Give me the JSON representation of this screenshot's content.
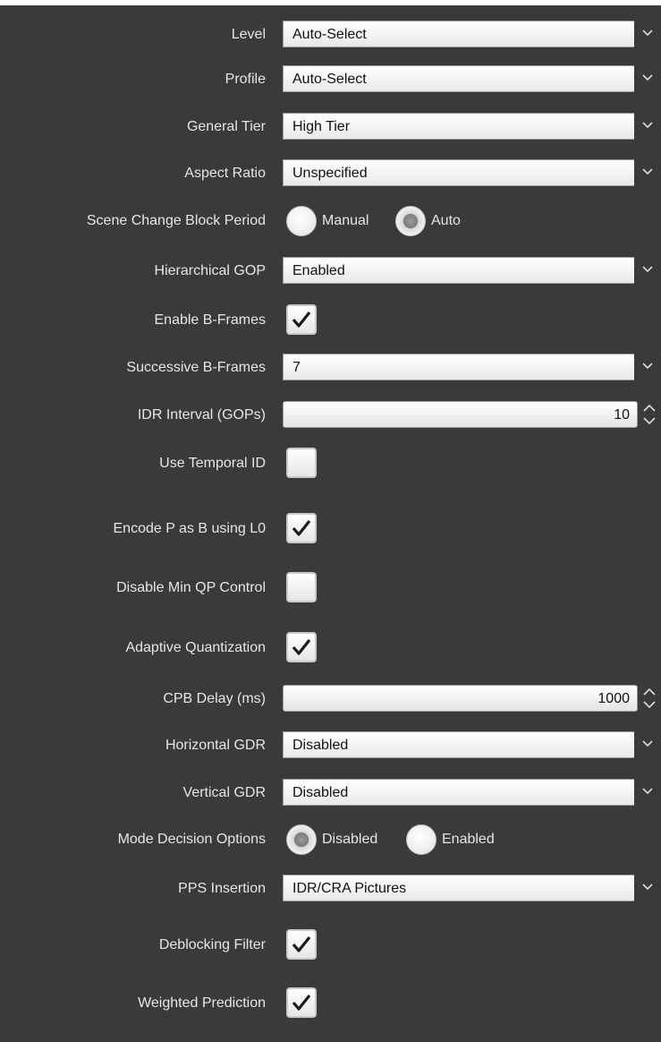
{
  "settings": {
    "level": {
      "label": "Level",
      "value": "Auto-Select"
    },
    "profile": {
      "label": "Profile",
      "value": "Auto-Select"
    },
    "general_tier": {
      "label": "General Tier",
      "value": "High Tier"
    },
    "aspect_ratio": {
      "label": "Aspect Ratio",
      "value": "Unspecified"
    },
    "scene_change": {
      "label": "Scene Change Block Period",
      "options": [
        "Manual",
        "Auto"
      ],
      "selected": "Auto"
    },
    "hierarchical_gop": {
      "label": "Hierarchical GOP",
      "value": "Enabled"
    },
    "enable_bframes": {
      "label": "Enable B-Frames",
      "checked": true
    },
    "successive_bframes": {
      "label": "Successive B-Frames",
      "value": "7"
    },
    "idr_interval": {
      "label": "IDR Interval (GOPs)",
      "value": "10"
    },
    "temporal_id": {
      "label": "Use Temporal ID",
      "checked": false
    },
    "encode_p_as_b": {
      "label": "Encode P as B using L0",
      "checked": true
    },
    "disable_min_qp": {
      "label": "Disable Min QP Control",
      "checked": false
    },
    "adaptive_quant": {
      "label": "Adaptive Quantization",
      "checked": true
    },
    "cpb_delay": {
      "label": "CPB Delay (ms)",
      "value": "1000"
    },
    "horizontal_gdr": {
      "label": "Horizontal GDR",
      "value": "Disabled"
    },
    "vertical_gdr": {
      "label": "Vertical GDR",
      "value": "Disabled"
    },
    "mode_decision": {
      "label": "Mode Decision Options",
      "options": [
        "Disabled",
        "Enabled"
      ],
      "selected": "Disabled"
    },
    "pps_insertion": {
      "label": "PPS Insertion",
      "value": "IDR/CRA Pictures"
    },
    "deblocking": {
      "label": "Deblocking Filter",
      "checked": true
    },
    "weighted_pred": {
      "label": "Weighted Prediction",
      "checked": true
    }
  },
  "icons": {
    "dropdown": "chevron-down-icon",
    "stepper": "up-down-arrows-icon",
    "check": "checkmark-icon"
  },
  "colors": {
    "panel_bg": "#3a3a3a",
    "label_text": "#e6e6e6"
  }
}
